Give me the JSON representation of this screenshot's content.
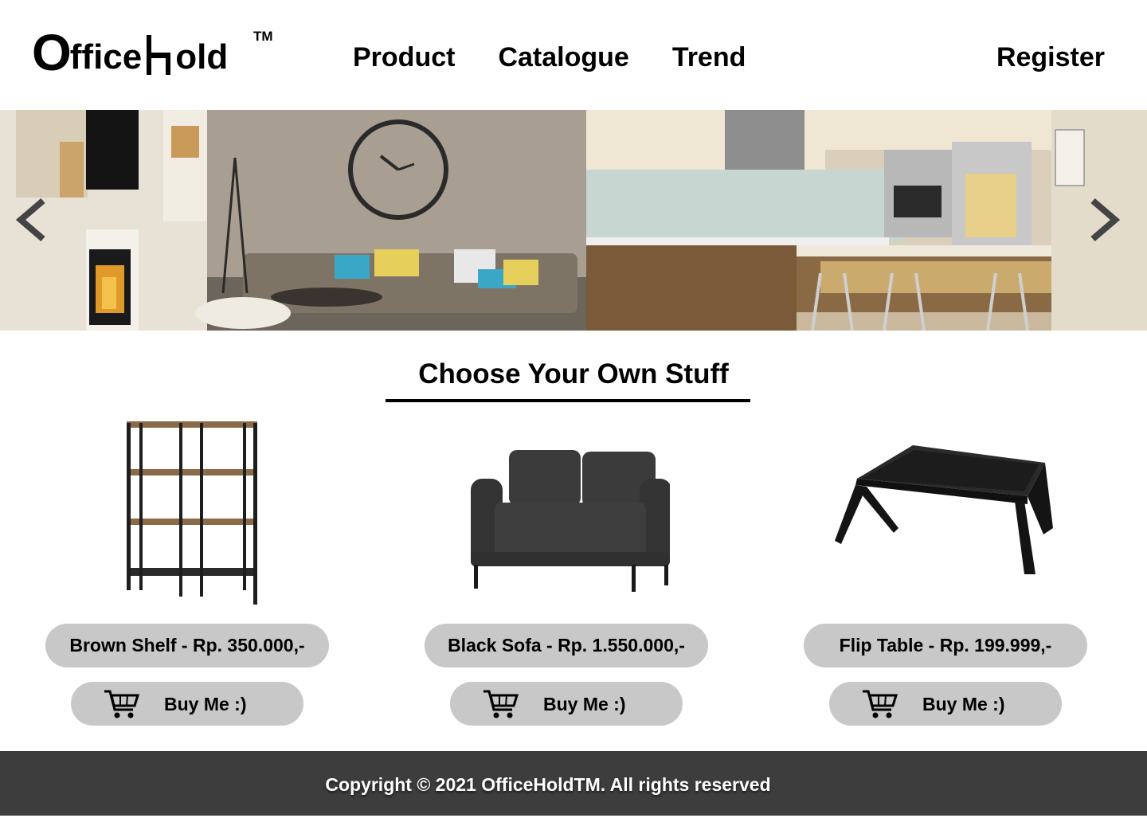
{
  "brand": {
    "logo_o": "O",
    "logo_part1": "ffice",
    "logo_part2": "old",
    "logo_tm": "TM"
  },
  "nav": {
    "items": [
      {
        "label": "Product"
      },
      {
        "label": "Catalogue"
      },
      {
        "label": "Trend"
      }
    ],
    "register_label": "Register"
  },
  "hero": {
    "prev_icon": "chevron-left-icon",
    "next_icon": "chevron-right-icon"
  },
  "section": {
    "title": "Choose Your Own Stuff"
  },
  "products": [
    {
      "price_label": "Brown Shelf - Rp. 350.000,-",
      "buy_label": "Buy Me :)",
      "icon": "shelf-image"
    },
    {
      "price_label": "Black Sofa - Rp. 1.550.000,-",
      "buy_label": "Buy Me :)",
      "icon": "sofa-image"
    },
    {
      "price_label": "Flip Table - Rp. 199.999,-",
      "buy_label": "Buy Me :)",
      "icon": "table-image"
    }
  ],
  "footer": {
    "copyright": "Copyright © 2021 OfficeHoldTM. All rights reserved"
  },
  "colors": {
    "pill_bg": "#c8c8c8",
    "footer_bg": "#3d3d3d",
    "text": "#000000"
  }
}
